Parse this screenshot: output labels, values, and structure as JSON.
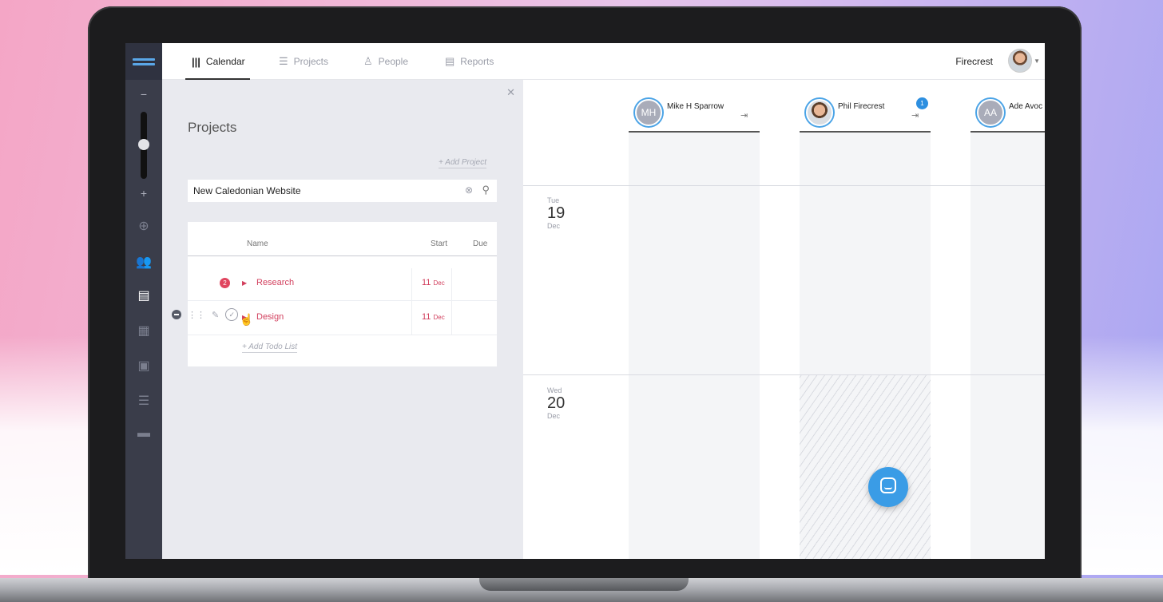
{
  "nav": {
    "tabs": [
      {
        "label": "Calendar",
        "icon": "bars-icon"
      },
      {
        "label": "Projects",
        "icon": "list-icon"
      },
      {
        "label": "People",
        "icon": "person-icon"
      },
      {
        "label": "Reports",
        "icon": "document-icon"
      }
    ],
    "user_name": "Firecrest"
  },
  "rail": {
    "zoom_minus": "−",
    "zoom_plus": "+"
  },
  "panel": {
    "title": "Projects",
    "add_project": "+  Add Project",
    "search_value": "New Caledonian Website",
    "columns": {
      "name": "Name",
      "start": "Start",
      "due": "Due"
    },
    "rows": [
      {
        "badge": "2",
        "name": "Research",
        "start_day": "11",
        "start_mon": "Dec"
      },
      {
        "name": "Design",
        "start_day": "11",
        "start_mon": "Dec"
      }
    ],
    "add_todo": "+  Add Todo List"
  },
  "calendar": {
    "people": [
      {
        "initials": "MH",
        "name": "Mike H Sparrow"
      },
      {
        "initials": "",
        "name": "Phil Firecrest",
        "notification": "1"
      },
      {
        "initials": "AA",
        "name": "Ade Avoc"
      }
    ],
    "days": [
      {
        "dow": "Tue",
        "num": "19",
        "mon": "Dec"
      },
      {
        "dow": "Wed",
        "num": "20",
        "mon": "Dec"
      }
    ]
  },
  "colors": {
    "accent": "#2d8fe0",
    "project_red": "#d23f5d",
    "rail_bg": "#3a3d4a",
    "panel_bg": "#e9eaef"
  }
}
